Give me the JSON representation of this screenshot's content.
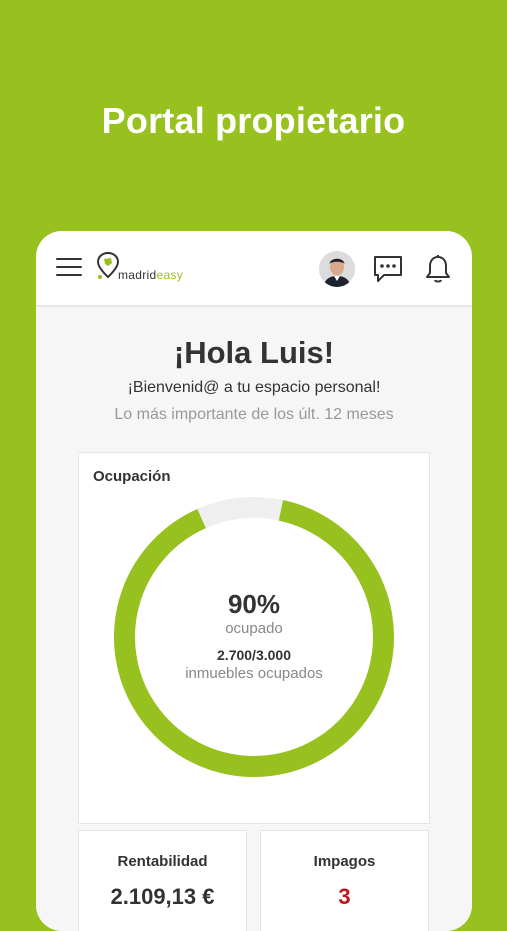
{
  "promo": {
    "headline": "Portal propietario"
  },
  "header": {
    "logo_text_part1": "madrid",
    "logo_text_part2": "easy",
    "icons": [
      "menu-icon",
      "avatar",
      "chat-icon",
      "bell-icon"
    ]
  },
  "dashboard": {
    "greeting": "¡Hola Luis!",
    "welcome": "¡Bienvenid@ a tu espacio personal!",
    "period": "Lo más importante de los últ. 12 meses",
    "occupancy": {
      "title": "Ocupación",
      "percent_text": "90%",
      "percent_value": 0.9,
      "percent_label": "ocupado",
      "count_text": "2.700/3.000",
      "count_label": "inmuebles ocupados"
    },
    "profitability": {
      "title": "Rentabilidad",
      "value": "2.109,13 €"
    },
    "unpaid": {
      "title": "Impagos",
      "value": "3"
    }
  },
  "colors": {
    "brand_green": "#97c11f",
    "text_dark": "#333333",
    "text_muted": "#999999",
    "alert_red": "#c0161b"
  }
}
